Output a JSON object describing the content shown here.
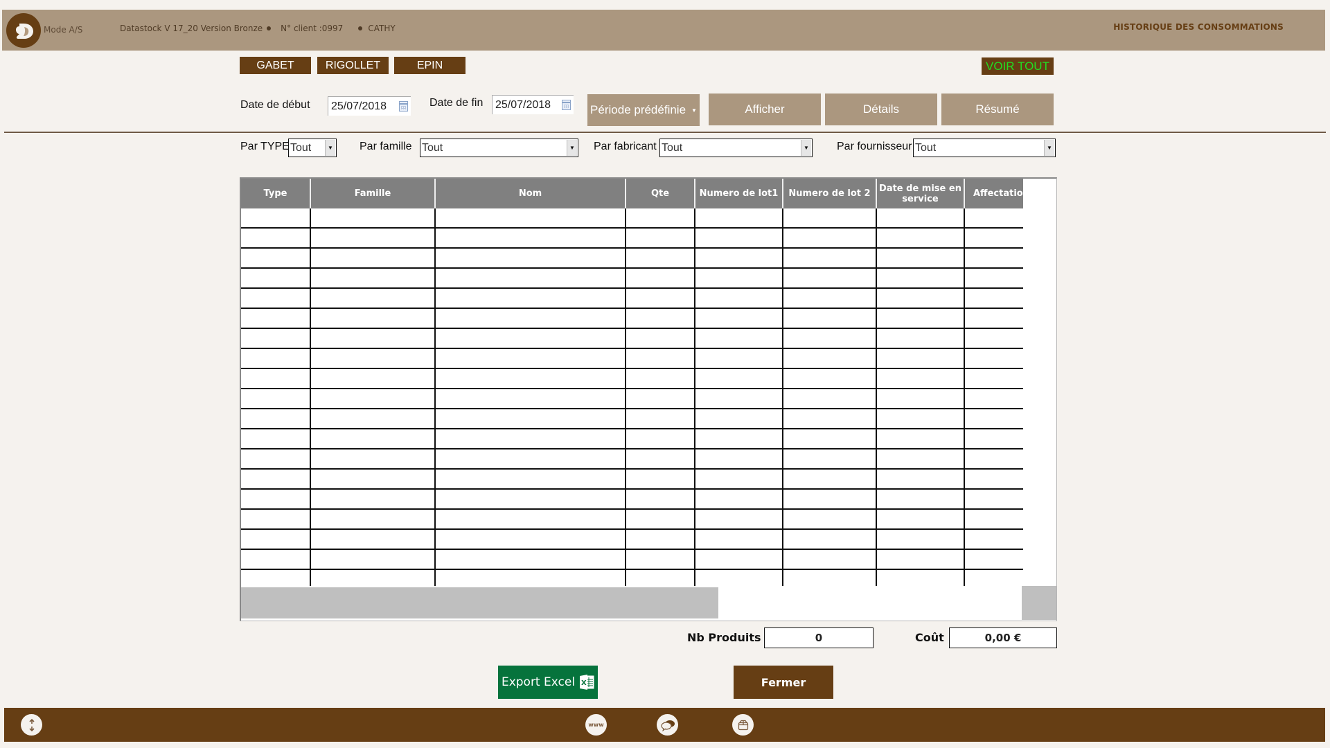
{
  "header": {
    "mode": "Mode A/S",
    "app_version": "Datastock V 17_20 Version Bronze",
    "client": "N° client :0997",
    "user": "CATHY",
    "page_title": "HISTORIQUE DES CONSOMMATIONS",
    "logo_icon": "datastock-logo-icon"
  },
  "sites": [
    {
      "label": "GABET"
    },
    {
      "label": "RIGOLLET"
    },
    {
      "label": "EPIN"
    }
  ],
  "voir_tout": "VOIR TOUT",
  "dates": {
    "start_label": "Date de début",
    "start_value": "25/07/2018",
    "end_label": "Date de fin",
    "end_value": "25/07/2018",
    "calendar_icon": "calendar-icon"
  },
  "actions": {
    "periode": "Période prédéfinie",
    "afficher": "Afficher",
    "details": "Détails",
    "resume": "Résumé"
  },
  "filters": {
    "type": {
      "label": "Par TYPE",
      "value": "Tout"
    },
    "famille": {
      "label": "Par famille",
      "value": "Tout"
    },
    "fabricant": {
      "label": "Par fabricant",
      "value": "Tout"
    },
    "fournisseur": {
      "label": "Par fournisseur",
      "value": "Tout"
    }
  },
  "table": {
    "columns": [
      "Type",
      "Famille",
      "Nom",
      "Qte",
      "Numero de lot1",
      "Numero de lot 2",
      "Date de mise en service",
      "Affectation"
    ],
    "rows": []
  },
  "totals": {
    "nb_produits_label": "Nb Produits",
    "nb_produits_value": "0",
    "cout_label": "Coût",
    "cout_value": "0,00 €"
  },
  "buttons": {
    "export_excel": "Export Excel",
    "fermer": "Fermer"
  },
  "footer": {
    "icons": [
      "scroll-up-down-icon",
      "www-icon",
      "chat-icon",
      "box-icon"
    ],
    "www_text": "www"
  },
  "colors": {
    "brand_brown": "#663e14",
    "header_tan": "#ab977f",
    "background": "#f5f2ee",
    "excel_green": "#06733c",
    "voir_tout_text": "#22dd22",
    "table_header": "#808080"
  }
}
